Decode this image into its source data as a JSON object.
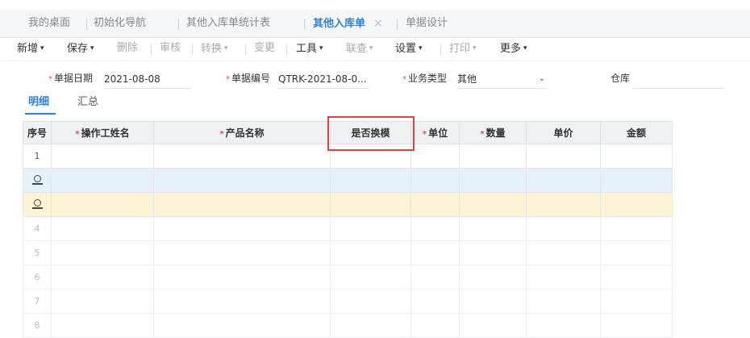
{
  "tabs": [
    {
      "label": "我的桌面",
      "active": false
    },
    {
      "label": "初始化导航",
      "active": false
    },
    {
      "label": "其他入库单统计表",
      "active": false
    },
    {
      "label": "其他入库单",
      "active": true,
      "close": "×"
    },
    {
      "label": "单据设计",
      "active": false
    }
  ],
  "toolbar": {
    "new": "新增",
    "save": "保存",
    "delete": "删除",
    "audit": "审核",
    "convert": "转换",
    "change": "变更",
    "tools": "工具",
    "query": "联查",
    "settings": "设置",
    "print": "打印",
    "more": "更多",
    "caret": "▾"
  },
  "form": {
    "date_label": "单据日期",
    "date_value": "2021-08-08",
    "no_label": "单据编号",
    "no_value": "QTRK-2021-08-0...",
    "type_label": "业务类型",
    "type_value": "其他",
    "warehouse_label": "仓库",
    "warehouse_value": "",
    "required_mark": "*",
    "chevron": "⌄"
  },
  "subtabs": {
    "detail": "明细",
    "summary": "汇总"
  },
  "grid": {
    "columns": [
      {
        "label": "序号",
        "required": false
      },
      {
        "label": "操作工姓名",
        "required": true
      },
      {
        "label": "产品名称",
        "required": true
      },
      {
        "label": "是否换模",
        "required": false
      },
      {
        "label": "单位",
        "required": true
      },
      {
        "label": "数量",
        "required": true
      },
      {
        "label": "单价",
        "required": false
      },
      {
        "label": "金额",
        "required": false
      }
    ],
    "rows": [
      "1",
      "",
      "",
      "4",
      "5",
      "6",
      "7",
      "8"
    ]
  },
  "colors": {
    "accent": "#2d7fe0",
    "highlight_box": "#e34040",
    "required": "#e04b4b",
    "row_selected": "#e6f1fb",
    "row_editing": "#fcf4d2"
  }
}
